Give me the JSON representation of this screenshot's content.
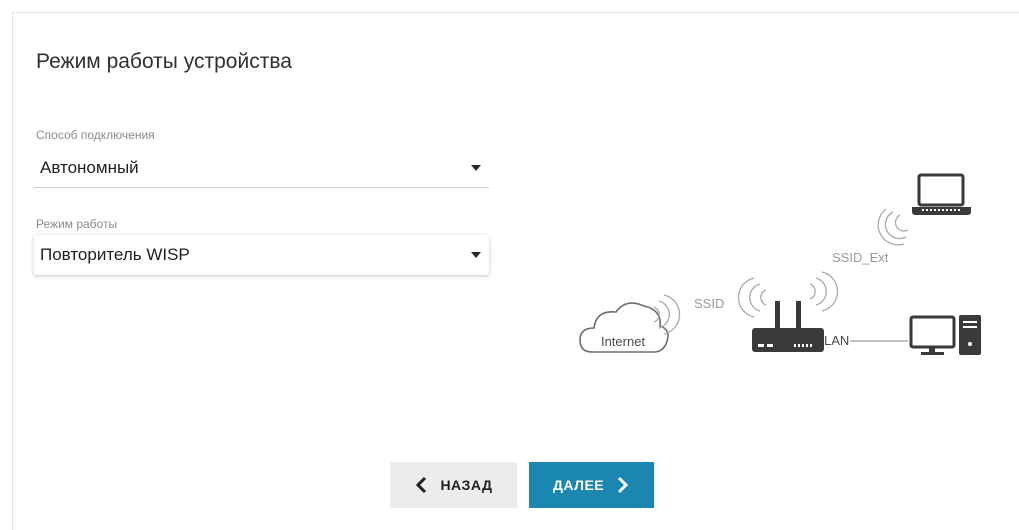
{
  "page": {
    "title": "Режим работы устройства"
  },
  "connection": {
    "label": "Способ подключения",
    "value": "Автономный"
  },
  "mode": {
    "label": "Режим работы",
    "value": "Повторитель WISP"
  },
  "diagram": {
    "internet": "Internet",
    "ssid": "SSID",
    "ssid_ext": "SSID_Ext",
    "lan": "LAN"
  },
  "buttons": {
    "back": "НАЗАД",
    "next": "ДАЛЕЕ"
  },
  "colors": {
    "accent": "#1b87b1",
    "back_bg": "#ececec",
    "diagram_line": "#9a9a9a",
    "device": "#3a3a3a"
  }
}
